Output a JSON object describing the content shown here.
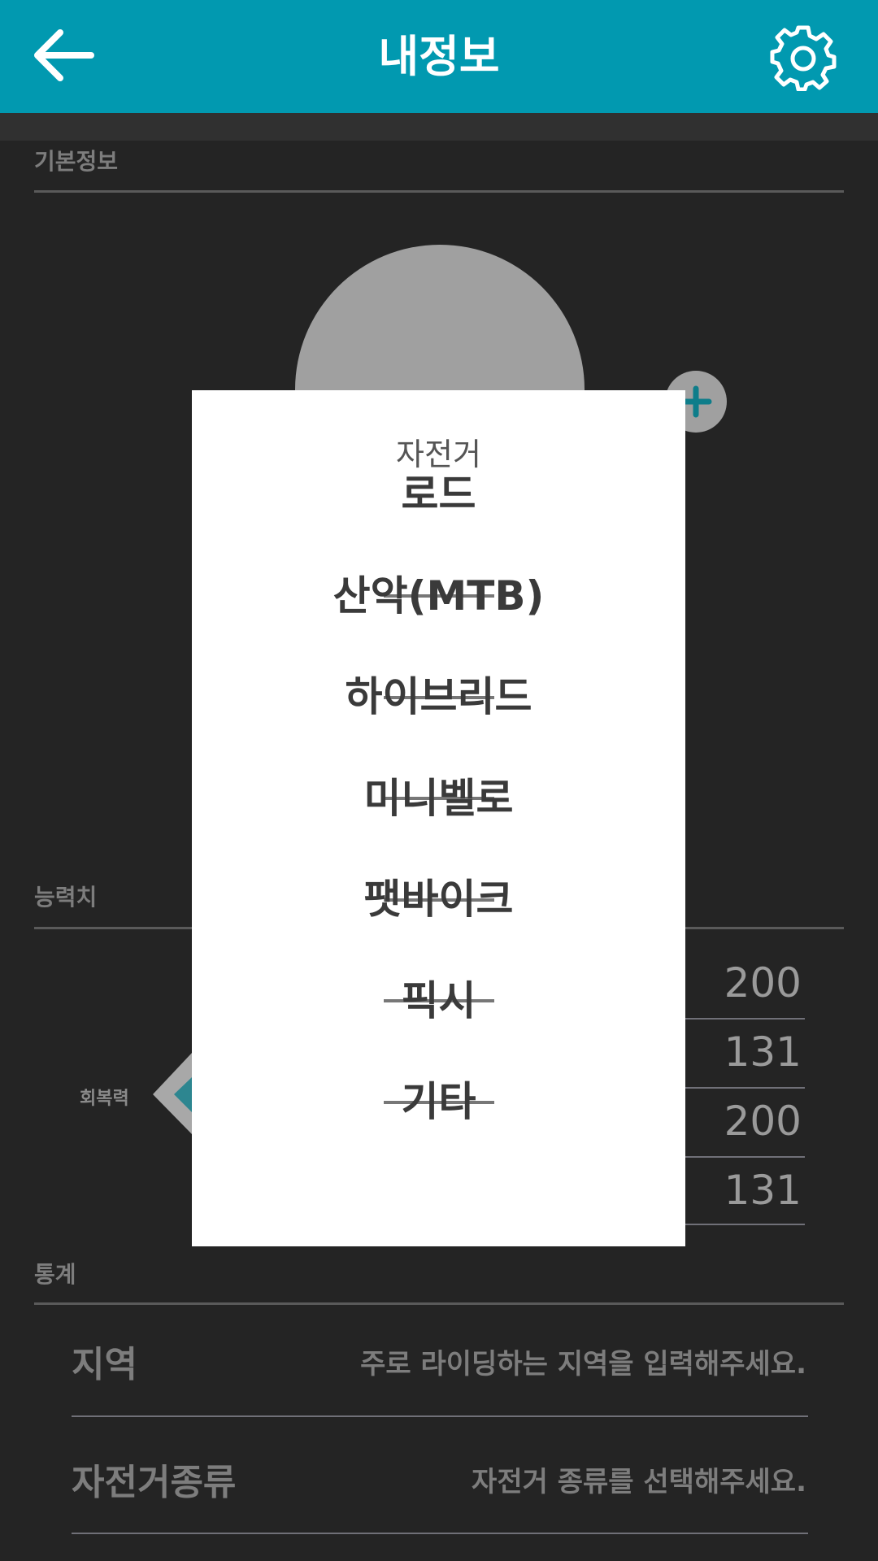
{
  "header": {
    "title": "내정보",
    "back_icon": "arrow-left-icon",
    "settings_icon": "gear-icon"
  },
  "sections": {
    "basic_info": "기본정보",
    "ability": "능력치",
    "stats": "통계"
  },
  "ability": {
    "radar_label": "회복력",
    "values": [
      "200",
      "131",
      "200",
      "131"
    ]
  },
  "rows": [
    {
      "label": "지역",
      "value": "주로 라이딩하는 지역을 입력해주세요."
    },
    {
      "label": "자전거종류",
      "value": "자전거 종류를 선택해주세요."
    }
  ],
  "dialog": {
    "title": "자전거",
    "options": [
      "로드",
      "산악(MTB)",
      "하이브리드",
      "미니벨로",
      "팻바이크",
      "픽시",
      "기타"
    ]
  },
  "colors": {
    "header_bg": "#0199b0",
    "background": "#242424",
    "accent": "#0e7d8a"
  }
}
